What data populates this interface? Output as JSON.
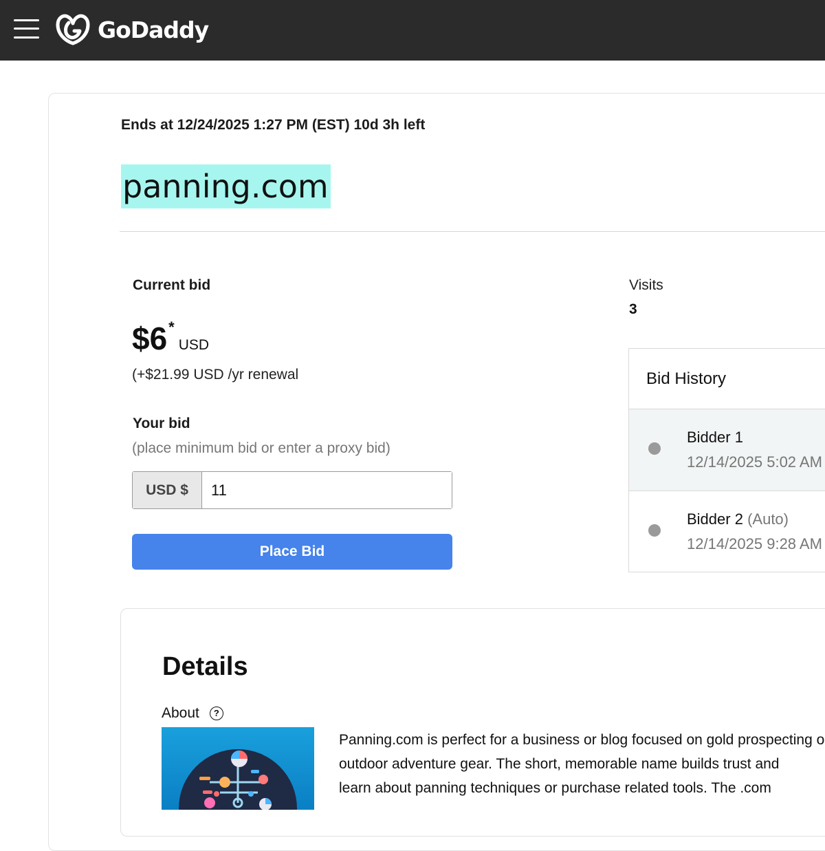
{
  "header": {
    "menu_icon": "hamburger-menu-icon",
    "logo_icon": "godaddy-logo-icon",
    "logo_text": "GoDaddy",
    "background_color": "#2b2b2b"
  },
  "auction": {
    "ends_text": "Ends at 12/24/2025 1:27 PM (EST) 10d 3h left",
    "domain": "panning.com",
    "domain_highlight_color": "#a6f6ef"
  },
  "bid": {
    "current_bid_label": "Current bid",
    "amount": "$6",
    "asterisk": "*",
    "currency": "USD",
    "renewal": "(+$21.99 USD /yr renewal",
    "your_bid_label": "Your bid",
    "your_bid_hint": "(place minimum bid or enter a proxy bid)",
    "currency_prefix": "USD $",
    "input_value": "11",
    "place_bid_label": "Place Bid",
    "button_color": "#4683ea"
  },
  "visits": {
    "label": "Visits",
    "value": "3"
  },
  "bid_history": {
    "title": "Bid History",
    "entries": [
      {
        "name": "Bidder 1",
        "auto": "",
        "time": "12/14/2025 5:02 AM"
      },
      {
        "name": "Bidder 2",
        "auto": "(Auto)",
        "time": "12/14/2025 9:28 AM"
      }
    ]
  },
  "details": {
    "title": "Details",
    "about_label": "About",
    "help_icon": "question-circle-icon",
    "help_glyph": "?",
    "image_icon": "network-globe-illustration",
    "description_lines": [
      "Panning.com is perfect for a business or blog focused on gold prospecting or",
      "outdoor adventure gear. The short, memorable name builds trust and",
      "learn about panning techniques or purchase related tools. The .com"
    ]
  }
}
